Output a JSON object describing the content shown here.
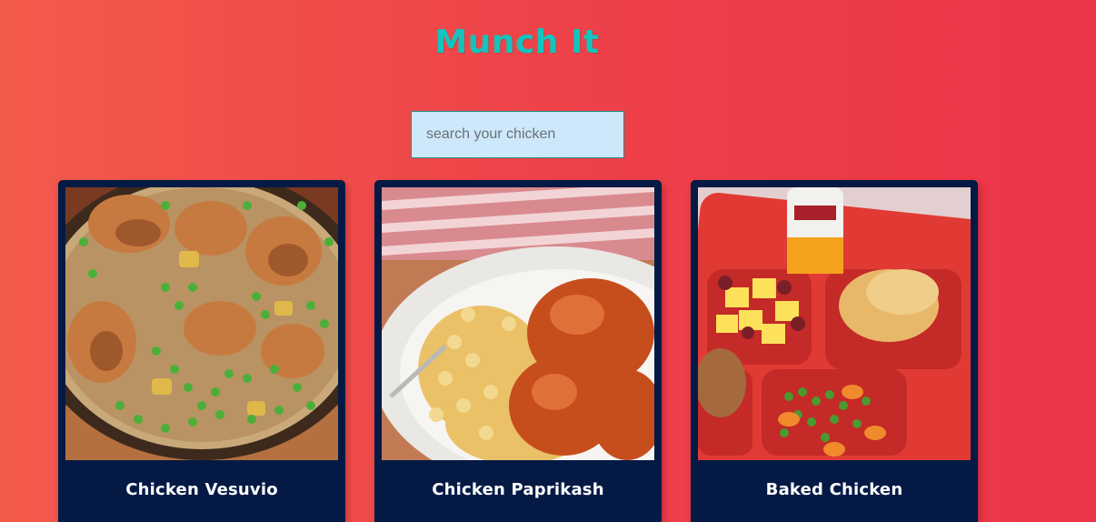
{
  "header": {
    "title": "Munch It"
  },
  "search": {
    "placeholder": "search your chicken",
    "value": ""
  },
  "colors": {
    "background_start": "#f25a4b",
    "background_end": "#ec3548",
    "title": "#12c4bd",
    "search_bg": "#cde8fb",
    "card_bg": "#041a45"
  },
  "recipes": [
    {
      "name": "Chicken Vesuvio",
      "image": "chicken-vesuvio-photo"
    },
    {
      "name": "Chicken Paprikash",
      "image": "chicken-paprikash-photo"
    },
    {
      "name": "Baked Chicken",
      "image": "baked-chicken-tray-photo"
    }
  ]
}
